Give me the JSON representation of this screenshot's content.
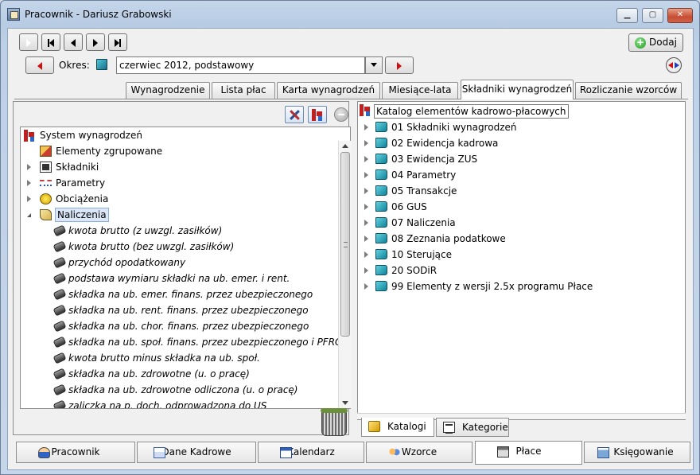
{
  "window": {
    "title": "Pracownik - Dariusz Grabowski"
  },
  "toolbar": {
    "add_label": "Dodaj"
  },
  "period": {
    "label": "Okres:",
    "value": "czerwiec 2012, podstawowy"
  },
  "tabs": [
    {
      "label": "Wynagrodzenie"
    },
    {
      "label": "Lista płac"
    },
    {
      "label": "Karta wynagrodzeń"
    },
    {
      "label": "Miesiące-lata"
    },
    {
      "label": "Składniki wynagrodzeń",
      "active": true
    },
    {
      "label": "Rozliczanie wzorców"
    }
  ],
  "left_tree": {
    "root": "System wynagrodzeń",
    "nodes": [
      "Elementy zgrupowane",
      "Składniki",
      "Parametry",
      "Obciążenia",
      "Naliczenia"
    ],
    "naliczenia_items": [
      "kwota brutto (z uwzgl. zasiłków)",
      "kwota brutto (bez uwzgl. zasiłków)",
      "przychód opodatkowany",
      "podstawa wymiaru składki na ub. emer. i rent.",
      "składka na ub. emer. finans. przez ubezpieczonego",
      "składka na ub. rent. finans. przez ubezpieczonego",
      "składka na ub. chor. finans. przez ubezpieczonego",
      "składka na ub. społ. finans. przez ubezpieczonego i PFRON",
      "kwota brutto minus składka na ub. społ.",
      "składka na ub. zdrowotne (u. o pracę)",
      "składka na ub. zdrowotne odliczona (u. o pracę)",
      "zaliczka na p. doch. odprowadzona do US"
    ]
  },
  "catalog": {
    "title": "Katalog elementów kadrowo-płacowych",
    "items": [
      "01 Składniki wynagrodzeń",
      "02 Ewidencja kadrowa",
      "03 Ewidencja ZUS",
      "04 Parametry",
      "05 Transakcje",
      "06 GUS",
      "07 Naliczenia",
      "08 Zeznania podatkowe",
      "10 Sterujące",
      "20 SODiR",
      "99 Elementy z wersji 2.5x programu Płace"
    ]
  },
  "right_bottom_tabs": [
    {
      "label": "Katalogi",
      "active": true
    },
    {
      "label": "Kategorie"
    }
  ],
  "footer_tabs": [
    {
      "label": "Pracownik"
    },
    {
      "label": "Dane Kadrowe"
    },
    {
      "label": "Kalendarz"
    },
    {
      "label": "Wzorce"
    },
    {
      "label": "Płace",
      "active": true
    },
    {
      "label": "Księgowanie"
    }
  ]
}
